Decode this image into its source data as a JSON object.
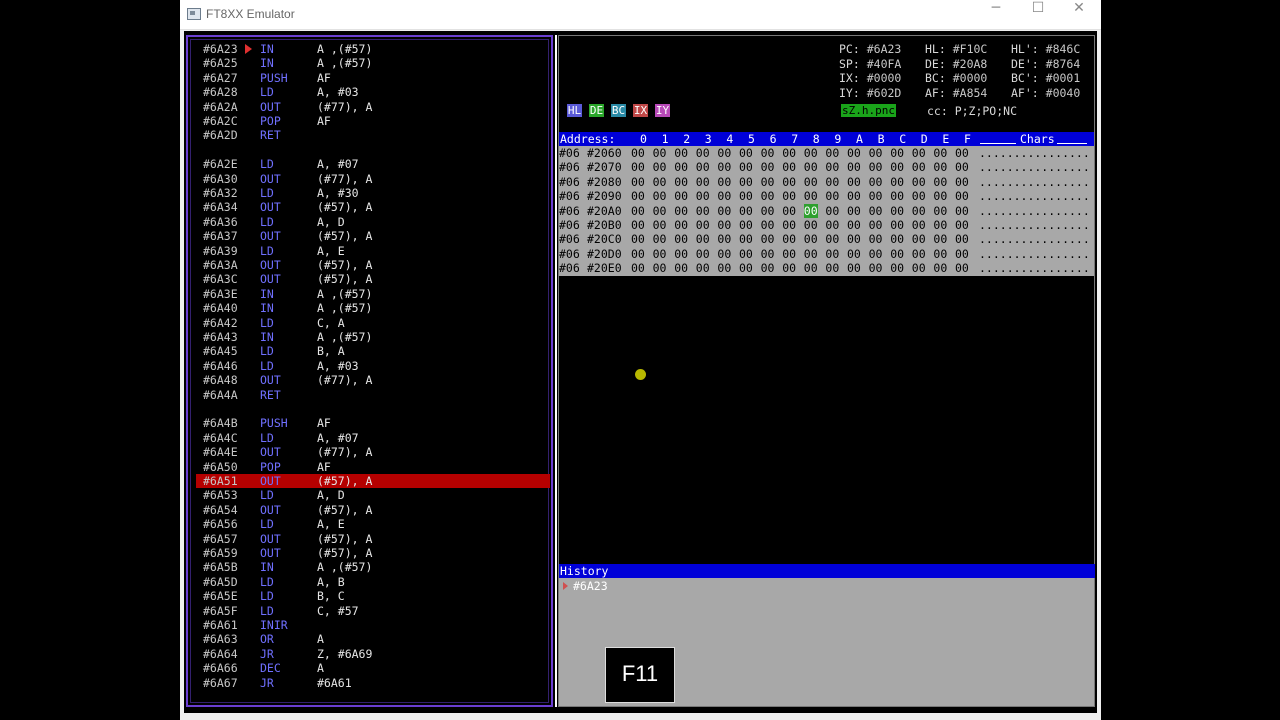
{
  "window": {
    "title": "FT8XX Emulator",
    "minimize": "─",
    "maximize": "☐",
    "close": "✕"
  },
  "disasm": [
    {
      "addr": "#6A23",
      "mn": "IN",
      "op": "A ,(#57)",
      "current": true
    },
    {
      "addr": "#6A25",
      "mn": "IN",
      "op": "A ,(#57)"
    },
    {
      "addr": "#6A27",
      "mn": "PUSH",
      "op": "AF"
    },
    {
      "addr": "#6A28",
      "mn": "LD",
      "op": "A, #03"
    },
    {
      "addr": "#6A2A",
      "mn": "OUT",
      "op": "(#77), A"
    },
    {
      "addr": "#6A2C",
      "mn": "POP",
      "op": "AF"
    },
    {
      "addr": "#6A2D",
      "mn": "RET",
      "op": ""
    },
    {
      "addr": "",
      "mn": "",
      "op": ""
    },
    {
      "addr": "#6A2E",
      "mn": "LD",
      "op": "A, #07"
    },
    {
      "addr": "#6A30",
      "mn": "OUT",
      "op": "(#77), A"
    },
    {
      "addr": "#6A32",
      "mn": "LD",
      "op": "A, #30"
    },
    {
      "addr": "#6A34",
      "mn": "OUT",
      "op": "(#57), A"
    },
    {
      "addr": "#6A36",
      "mn": "LD",
      "op": "A, D"
    },
    {
      "addr": "#6A37",
      "mn": "OUT",
      "op": "(#57), A"
    },
    {
      "addr": "#6A39",
      "mn": "LD",
      "op": "A, E"
    },
    {
      "addr": "#6A3A",
      "mn": "OUT",
      "op": "(#57), A"
    },
    {
      "addr": "#6A3C",
      "mn": "OUT",
      "op": "(#57), A"
    },
    {
      "addr": "#6A3E",
      "mn": "IN",
      "op": "A ,(#57)"
    },
    {
      "addr": "#6A40",
      "mn": "IN",
      "op": "A ,(#57)"
    },
    {
      "addr": "#6A42",
      "mn": "LD",
      "op": "C, A"
    },
    {
      "addr": "#6A43",
      "mn": "IN",
      "op": "A ,(#57)"
    },
    {
      "addr": "#6A45",
      "mn": "LD",
      "op": "B, A"
    },
    {
      "addr": "#6A46",
      "mn": "LD",
      "op": "A, #03"
    },
    {
      "addr": "#6A48",
      "mn": "OUT",
      "op": "(#77), A"
    },
    {
      "addr": "#6A4A",
      "mn": "RET",
      "op": ""
    },
    {
      "addr": "",
      "mn": "",
      "op": ""
    },
    {
      "addr": "#6A4B",
      "mn": "PUSH",
      "op": "AF"
    },
    {
      "addr": "#6A4C",
      "mn": "LD",
      "op": "A, #07"
    },
    {
      "addr": "#6A4E",
      "mn": "OUT",
      "op": "(#77), A"
    },
    {
      "addr": "#6A50",
      "mn": "POP",
      "op": "AF"
    },
    {
      "addr": "#6A51",
      "mn": "OUT",
      "op": "(#57), A",
      "selected": true
    },
    {
      "addr": "#6A53",
      "mn": "LD",
      "op": "A, D"
    },
    {
      "addr": "#6A54",
      "mn": "OUT",
      "op": "(#57), A"
    },
    {
      "addr": "#6A56",
      "mn": "LD",
      "op": "A, E"
    },
    {
      "addr": "#6A57",
      "mn": "OUT",
      "op": "(#57), A"
    },
    {
      "addr": "#6A59",
      "mn": "OUT",
      "op": "(#57), A"
    },
    {
      "addr": "#6A5B",
      "mn": "IN",
      "op": "A ,(#57)"
    },
    {
      "addr": "#6A5D",
      "mn": "LD",
      "op": "A, B"
    },
    {
      "addr": "#6A5E",
      "mn": "LD",
      "op": "B, C"
    },
    {
      "addr": "#6A5F",
      "mn": "LD",
      "op": "C, #57"
    },
    {
      "addr": "#6A61",
      "mn": "INIR",
      "op": ""
    },
    {
      "addr": "#6A63",
      "mn": "OR",
      "op": "A"
    },
    {
      "addr": "#6A64",
      "mn": "JR",
      "op": "Z, #6A69"
    },
    {
      "addr": "#6A66",
      "mn": "DEC",
      "op": "A"
    },
    {
      "addr": "#6A67",
      "mn": "JR",
      "op": "#6A61"
    }
  ],
  "registers": [
    [
      {
        "l": "PC:",
        "v": "#6A23"
      },
      {
        "l": "HL:",
        "v": "#F10C"
      },
      {
        "l": "HL':",
        "v": "#846C"
      }
    ],
    [
      {
        "l": "SP:",
        "v": "#40FA"
      },
      {
        "l": "DE:",
        "v": "#20A8"
      },
      {
        "l": "DE':",
        "v": "#8764"
      }
    ],
    [
      {
        "l": "IX:",
        "v": "#0000"
      },
      {
        "l": "BC:",
        "v": "#0000"
      },
      {
        "l": "BC':",
        "v": "#0001"
      }
    ],
    [
      {
        "l": "IY:",
        "v": "#602D"
      },
      {
        "l": "AF:",
        "v": "#A854"
      },
      {
        "l": "AF':",
        "v": "#0040"
      }
    ]
  ],
  "reg_buttons": [
    {
      "label": "HL",
      "color": "#5a5ad8"
    },
    {
      "label": "DE",
      "color": "#2aa62a"
    },
    {
      "label": "BC",
      "color": "#2a8aa6"
    },
    {
      "label": "IX",
      "color": "#c04848"
    },
    {
      "label": "IY",
      "color": "#b84ab8"
    }
  ],
  "flags_string": "sZ.h.pnc",
  "cc_text": "cc: P;Z;PO;NC",
  "memory": {
    "header_label": "Address:",
    "columns": [
      "0",
      "1",
      "2",
      "3",
      "4",
      "5",
      "6",
      "7",
      "8",
      "9",
      "A",
      "B",
      "C",
      "D",
      "E",
      "F"
    ],
    "chars_label": "Chars",
    "rows": [
      {
        "bank": "#06",
        "addr": "#2060",
        "bytes": [
          "00",
          "00",
          "00",
          "00",
          "00",
          "00",
          "00",
          "00",
          "00",
          "00",
          "00",
          "00",
          "00",
          "00",
          "00",
          "00"
        ],
        "chars": "................"
      },
      {
        "bank": "#06",
        "addr": "#2070",
        "bytes": [
          "00",
          "00",
          "00",
          "00",
          "00",
          "00",
          "00",
          "00",
          "00",
          "00",
          "00",
          "00",
          "00",
          "00",
          "00",
          "00"
        ],
        "chars": "................"
      },
      {
        "bank": "#06",
        "addr": "#2080",
        "bytes": [
          "00",
          "00",
          "00",
          "00",
          "00",
          "00",
          "00",
          "00",
          "00",
          "00",
          "00",
          "00",
          "00",
          "00",
          "00",
          "00"
        ],
        "chars": "................"
      },
      {
        "bank": "#06",
        "addr": "#2090",
        "bytes": [
          "00",
          "00",
          "00",
          "00",
          "00",
          "00",
          "00",
          "00",
          "00",
          "00",
          "00",
          "00",
          "00",
          "00",
          "00",
          "00"
        ],
        "chars": "................"
      },
      {
        "bank": "#06",
        "addr": "#20A0",
        "bytes": [
          "00",
          "00",
          "00",
          "00",
          "00",
          "00",
          "00",
          "00",
          "00",
          "00",
          "00",
          "00",
          "00",
          "00",
          "00",
          "00"
        ],
        "chars": "................",
        "cursor": 8
      },
      {
        "bank": "#06",
        "addr": "#20B0",
        "bytes": [
          "00",
          "00",
          "00",
          "00",
          "00",
          "00",
          "00",
          "00",
          "00",
          "00",
          "00",
          "00",
          "00",
          "00",
          "00",
          "00"
        ],
        "chars": "................"
      },
      {
        "bank": "#06",
        "addr": "#20C0",
        "bytes": [
          "00",
          "00",
          "00",
          "00",
          "00",
          "00",
          "00",
          "00",
          "00",
          "00",
          "00",
          "00",
          "00",
          "00",
          "00",
          "00"
        ],
        "chars": "................"
      },
      {
        "bank": "#06",
        "addr": "#20D0",
        "bytes": [
          "00",
          "00",
          "00",
          "00",
          "00",
          "00",
          "00",
          "00",
          "00",
          "00",
          "00",
          "00",
          "00",
          "00",
          "00",
          "00"
        ],
        "chars": "................"
      },
      {
        "bank": "#06",
        "addr": "#20E0",
        "bytes": [
          "00",
          "00",
          "00",
          "00",
          "00",
          "00",
          "00",
          "00",
          "00",
          "00",
          "00",
          "00",
          "00",
          "00",
          "00",
          "00"
        ],
        "chars": "................"
      }
    ]
  },
  "history": {
    "title": "History",
    "entries": [
      "#6A23"
    ]
  },
  "key_overlay": "F11"
}
